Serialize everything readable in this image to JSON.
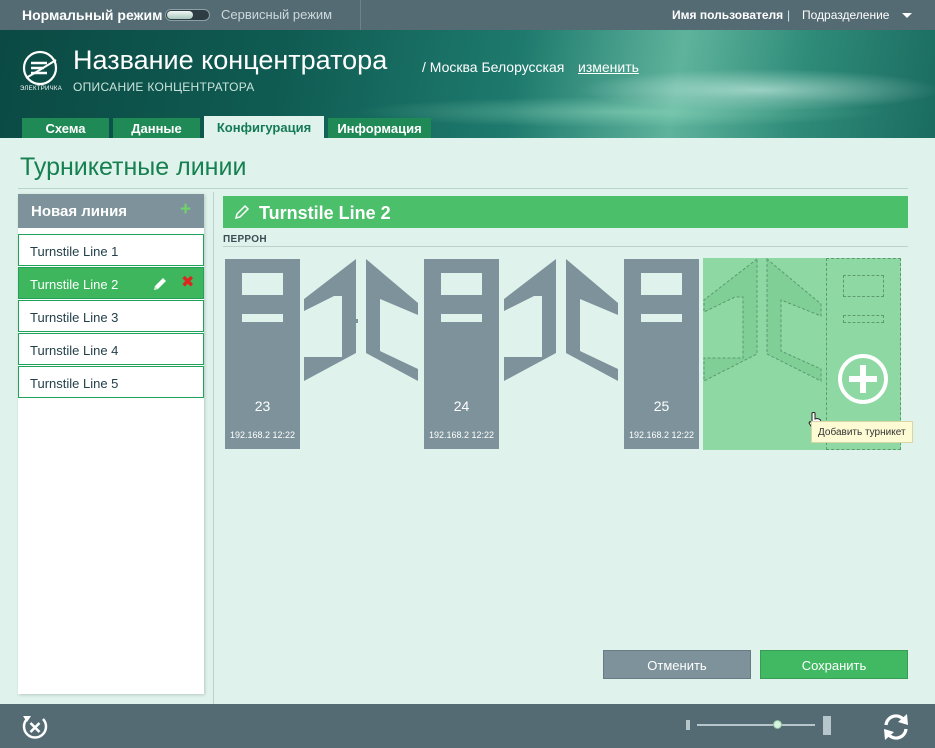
{
  "topbar": {
    "normal_mode": "Нормальный режим",
    "service_mode": "Сервисный режим",
    "mode_toggle_state": "normal",
    "user_name": "Имя пользователя",
    "separator": "|",
    "department": "Подразделение"
  },
  "header": {
    "logo_text": "ЭЛЕКТРИЧКА",
    "hub_title": "Название концентратора",
    "hub_location": "/ Москва Белорусская",
    "change_link": "изменить",
    "hub_description": "ОПИСАНИЕ КОНЦЕНТРАТОРА",
    "tabs": [
      {
        "label": "Схема",
        "active": false
      },
      {
        "label": "Данные",
        "active": false
      },
      {
        "label": "Конфигурация",
        "active": true
      },
      {
        "label": "Информация",
        "active": false
      }
    ]
  },
  "page": {
    "title": "Турникетные линии"
  },
  "lines_panel": {
    "new_line_label": "Новая линия",
    "add_glyph": "+",
    "delete_glyph": "✖",
    "items": [
      {
        "label": "Turnstile Line 1",
        "selected": false
      },
      {
        "label": "Turnstile Line 2",
        "selected": true
      },
      {
        "label": "Turnstile Line 3",
        "selected": false
      },
      {
        "label": "Turnstile Line 4",
        "selected": false
      },
      {
        "label": "Turnstile Line 5",
        "selected": false
      }
    ]
  },
  "editor": {
    "line_name": "Turnstile Line 2",
    "platform_label": "ПЕРРОН",
    "turnstiles": [
      {
        "number": "23",
        "ip": "192.168.2 12:22"
      },
      {
        "number": "24",
        "ip": "192.168.2 12:22"
      },
      {
        "number": "25",
        "ip": "192.168.2 12:22"
      }
    ],
    "add_tooltip": "Добавить турникет",
    "cancel_label": "Отменить",
    "save_label": "Сохранить"
  },
  "colors": {
    "accent_green": "#41b963",
    "header_green": "#4cbf6a",
    "cabinet_gray": "#7d929a",
    "bar_gray": "#556b73",
    "background": "#dff3ec",
    "delete_red": "#e0251f"
  },
  "icons": {
    "logo": "elektrichka-logo-icon",
    "edit": "pencil-icon",
    "add": "plus-icon",
    "delete": "delete-x-icon",
    "add_turnstile": "plus-circle-icon",
    "exit": "exit-icon",
    "refresh": "refresh-icon",
    "dropdown": "chevron-down-icon"
  },
  "zoom": {
    "level": 0.68
  }
}
